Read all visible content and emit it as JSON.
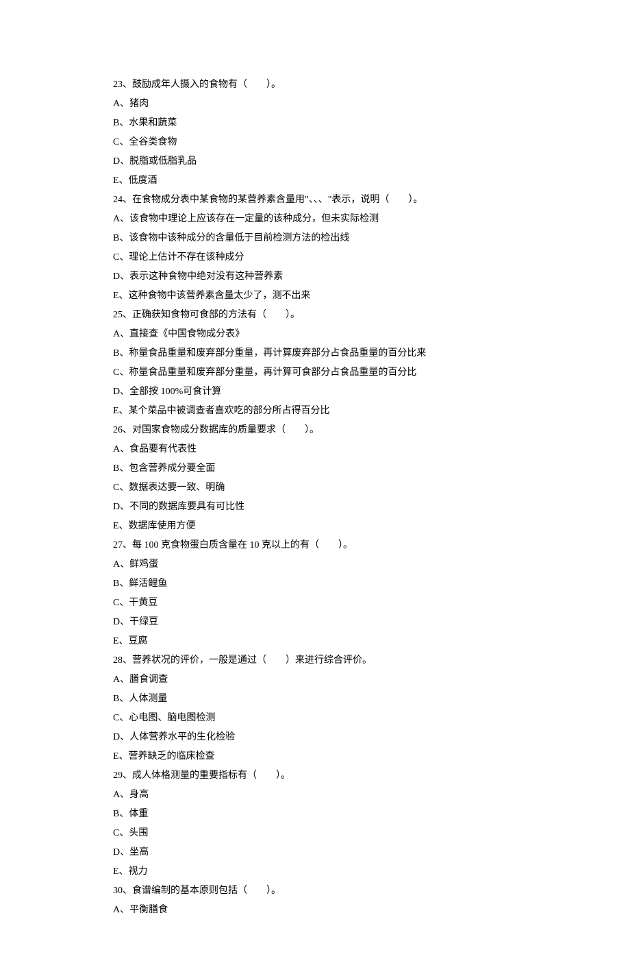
{
  "questions": [
    {
      "number": "23",
      "text": "23、鼓励成年人摄入的食物有（　　）。",
      "options": [
        "A、猪肉",
        "B、水果和蔬菜",
        "C、全谷类食物",
        "D、脱脂或低脂乳品",
        "E、低度酒"
      ]
    },
    {
      "number": "24",
      "text": "24、在食物成分表中某食物的某营养素含量用\"、、、\"表示，说明（　　）。",
      "options": [
        "A、该食物中理论上应该存在一定量的该种成分，但未实际检测",
        "B、该食物中该种成分的含量低于目前检测方法的检出线",
        "C、理论上估计不存在该种成分",
        "D、表示这种食物中绝对没有这种营养素",
        "E、这种食物中该营养素含量太少了，测不出来"
      ]
    },
    {
      "number": "25",
      "text": "25、正确获知食物可食部的方法有（　　）。",
      "options": [
        "A、直接查《中国食物成分表》",
        "B、称量食品重量和废弃部分重量，再计算废弃部分占食品重量的百分比来",
        "C、称量食品重量和废弃部分重量，再计算可食部分占食品重量的百分比",
        "D、全部按 100%可食计算",
        "E、某个菜品中被调查者喜欢吃的部分所占得百分比"
      ]
    },
    {
      "number": "26",
      "text": "26、对国家食物成分数据库的质量要求（　　）。",
      "options": [
        "A、食品要有代表性",
        "B、包含营养成分要全面",
        "C、数据表达要一致、明确",
        "D、不同的数据库要具有可比性",
        "E、数据库使用方便"
      ]
    },
    {
      "number": "27",
      "text": "27、每 100 克食物蛋白质含量在 10 克以上的有（　　）。",
      "options": [
        "A、鲜鸡蛋",
        "B、鲜活鲤鱼",
        "C、干黄豆",
        "D、干绿豆",
        "E、豆腐"
      ]
    },
    {
      "number": "28",
      "text": "28、营养状况的评价，一般是通过（　　）来进行综合评价。",
      "options": [
        "A、膳食调查",
        "B、人体测量",
        "C、心电图、脑电图检测",
        "D、人体营养水平的生化检验",
        "E、营养缺乏的临床检查"
      ]
    },
    {
      "number": "29",
      "text": "29、成人体格测量的重要指标有（　　）。",
      "options": [
        "A、身高",
        "B、体重",
        "C、头围",
        "D、坐高",
        "E、视力"
      ]
    },
    {
      "number": "30",
      "text": "30、食谱编制的基本原则包括（　　）。",
      "options": [
        "A、平衡膳食"
      ]
    }
  ]
}
